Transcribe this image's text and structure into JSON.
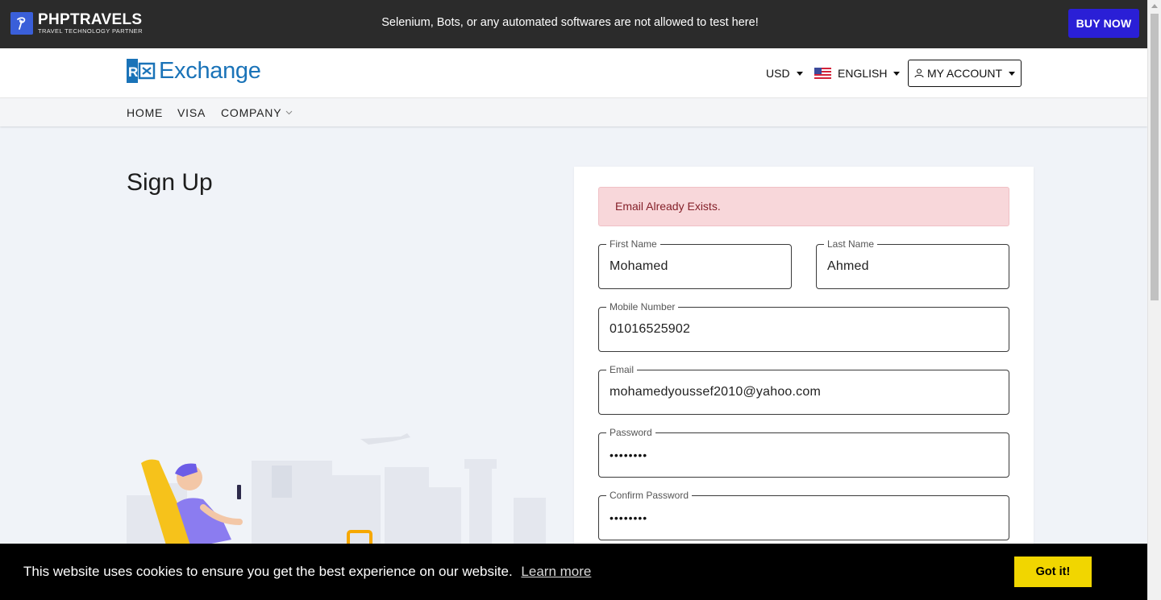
{
  "topbar": {
    "brand_name": "PHPTRAVELS",
    "brand_tagline": "TRAVEL TECHNOLOGY PARTNER",
    "notice": "Selenium, Bots, or any automated softwares are not allowed to test here!",
    "buy_label": "BUY NOW"
  },
  "header": {
    "logo_text": "Exchange",
    "currency": "USD",
    "language": "ENGLISH",
    "account_label": "MY ACCOUNT"
  },
  "nav": {
    "items": [
      "HOME",
      "VISA",
      "COMPANY"
    ]
  },
  "page": {
    "title": "Sign Up"
  },
  "form": {
    "alert": "Email Already Exists.",
    "first_name": {
      "label": "First Name",
      "value": "Mohamed"
    },
    "last_name": {
      "label": "Last Name",
      "value": "Ahmed"
    },
    "mobile": {
      "label": "Mobile Number",
      "value": "01016525902"
    },
    "email": {
      "label": "Email",
      "value": "mohamedyoussef2010@yahoo.com"
    },
    "password": {
      "label": "Password",
      "value": "••••••••"
    },
    "confirm_password": {
      "label": "Confirm Password",
      "value": "••••••••"
    }
  },
  "cookie": {
    "message": "This website uses cookies to ensure you get the best experience on our website.",
    "learn_more": "Learn more",
    "accept": "Got it!"
  },
  "colors": {
    "buy_button": "#2a1fd6",
    "logo_blue": "#1a73b8",
    "alert_bg": "#f8d7da",
    "cookie_button": "#f1d600"
  }
}
